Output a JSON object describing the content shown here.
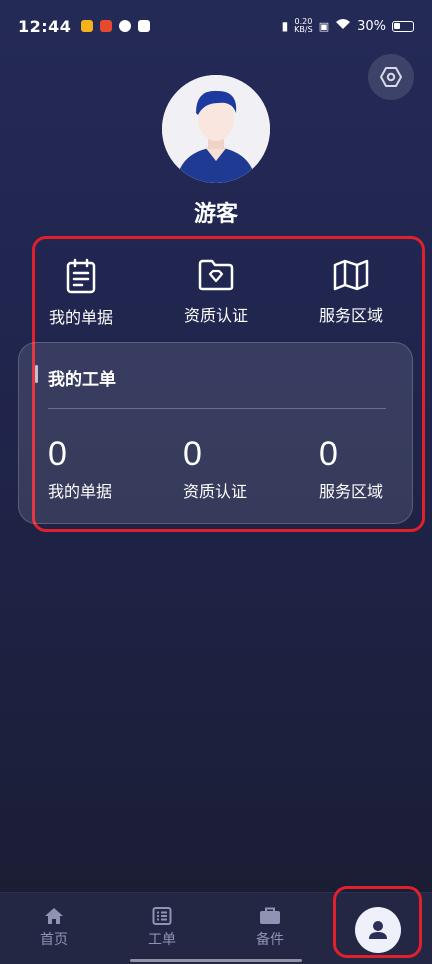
{
  "status_bar": {
    "time": "12:44",
    "net_speed_value": "0.20",
    "net_speed_unit": "KB/S",
    "battery": "30%"
  },
  "profile": {
    "username": "游客"
  },
  "shortcuts": [
    {
      "label": "我的单据",
      "icon": "clipboard-icon"
    },
    {
      "label": "资质认证",
      "icon": "folder-diamond-icon"
    },
    {
      "label": "服务区域",
      "icon": "map-icon"
    }
  ],
  "work_order_card": {
    "title": "我的工单",
    "stats": [
      {
        "value": "0",
        "label": "我的单据"
      },
      {
        "value": "0",
        "label": "资质认证"
      },
      {
        "value": "0",
        "label": "服务区域"
      }
    ]
  },
  "tab_bar": {
    "tabs": [
      {
        "label": "首页",
        "icon": "home-icon"
      },
      {
        "label": "工单",
        "icon": "list-icon"
      },
      {
        "label": "备件",
        "icon": "briefcase-icon"
      },
      {
        "label": "",
        "icon": "person-icon",
        "active": true
      }
    ]
  },
  "colors": {
    "background_top": "#242a56",
    "background_bottom": "#1a1c30",
    "highlight_red": "#e0202a",
    "tab_inactive": "#8f93b4"
  }
}
